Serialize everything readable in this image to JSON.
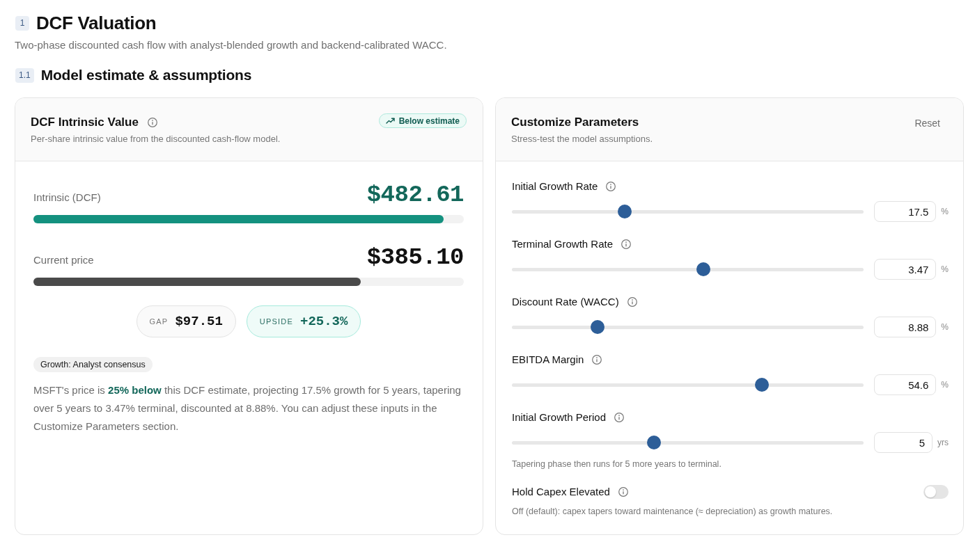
{
  "header": {
    "number": "1",
    "title": "DCF Valuation",
    "subtitle": "Two-phase discounted cash flow with analyst-blended growth and backend-calibrated WACC."
  },
  "section": {
    "number": "1.1",
    "title": "Model estimate & assumptions"
  },
  "valuation_card": {
    "title": "DCF Intrinsic Value",
    "status_badge": "Below estimate",
    "subtitle": "Per-share intrinsic value from the discounted cash-flow model.",
    "bars": [
      {
        "kind": "intrinsic",
        "label": "Intrinsic (DCF)",
        "value": "$482.61",
        "level": 0.953
      },
      {
        "kind": "price",
        "label": "Current price",
        "value": "$385.10",
        "level": 0.76
      }
    ],
    "pills": [
      {
        "kind": "neutral",
        "label": "GAP",
        "value": "$97.51"
      },
      {
        "kind": "positive",
        "label": "UPSIDE",
        "value": "+25.3%"
      }
    ],
    "growth_tag": "Growth: Analyst consensus",
    "summary": "MSFT's price is **25% below** this DCF estimate, projecting 17.5% growth for 5 years, tapering over 5 years to 3.47% terminal, discounted at 8.88%. You can adjust these inputs in the Customize Parameters section."
  },
  "parameters_card": {
    "title": "Customize Parameters",
    "reset_button": "Reset",
    "subtitle": "Stress-test the model assumptions.",
    "sliders": [
      {
        "label": "Initial Growth Rate",
        "level": 0.32,
        "value": "17.5",
        "unit": "%"
      },
      {
        "label": "Terminal Growth Rate",
        "level": 0.545,
        "value": "3.47",
        "unit": "%"
      },
      {
        "label": "Discount Rate (WACC)",
        "level": 0.243,
        "value": "8.88",
        "unit": "%"
      },
      {
        "label": "EBITDA Margin",
        "level": 0.71,
        "value": "54.6",
        "unit": "%"
      },
      {
        "label": "Initial Growth Period",
        "level": 0.403,
        "value": "5",
        "unit": "yrs",
        "hint": "Tapering phase then runs for 5 more years to terminal."
      }
    ],
    "toggle": {
      "label": "Hold Capex Elevated",
      "on": false,
      "hint": "Off (default): capex tapers toward maintenance (≈ depreciation) as growth matures."
    }
  }
}
